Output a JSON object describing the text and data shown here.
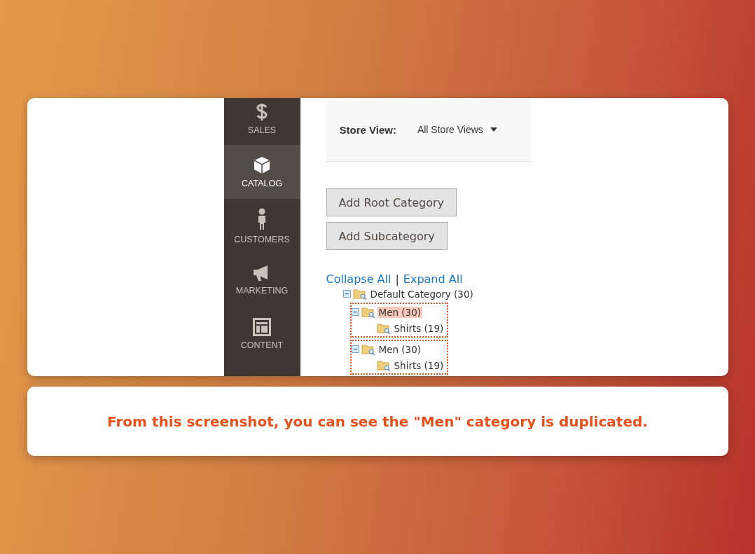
{
  "sidebar": {
    "items": [
      {
        "label": "SALES",
        "selected": false
      },
      {
        "label": "CATALOG",
        "selected": true
      },
      {
        "label": "CUSTOMERS",
        "selected": false
      },
      {
        "label": "MARKETING",
        "selected": false
      },
      {
        "label": "CONTENT",
        "selected": false
      }
    ]
  },
  "store_view": {
    "label": "Store View:",
    "value": "All Store Views"
  },
  "buttons": [
    "Add Root Category",
    "Add Subcategory"
  ],
  "tree_links": {
    "collapse": "Collapse All",
    "separator": "|",
    "expand": "Expand All"
  },
  "tree": [
    {
      "label": "Default Category (30)",
      "expanded": true,
      "selected": false,
      "annotated": false,
      "children": [
        {
          "label": "Men (30)",
          "expanded": true,
          "selected": true,
          "annotated": true,
          "children": [
            {
              "label": "Shirts (19)",
              "selected": false,
              "annotated": false
            }
          ]
        },
        {
          "label": "Men (30)",
          "expanded": true,
          "selected": false,
          "annotated": true,
          "children": [
            {
              "label": "Shirts (19)",
              "selected": false,
              "annotated": false
            }
          ]
        }
      ]
    }
  ],
  "caption": "From this screenshot, you can see the \"Men\" category is duplicated."
}
